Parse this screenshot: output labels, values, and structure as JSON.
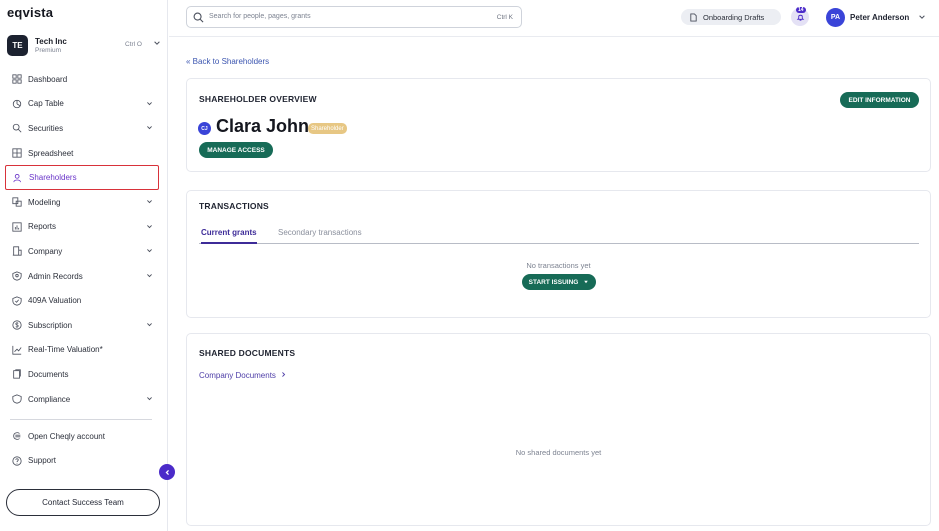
{
  "sidebar": {
    "logo": "eqvista",
    "company": {
      "initials": "TE",
      "name": "Tech Inc",
      "plan": "Premium",
      "shortcut": "Ctrl O"
    },
    "items": [
      {
        "label": "Dashboard",
        "icon": "dashboard-icon",
        "expandable": false
      },
      {
        "label": "Cap Table",
        "icon": "pie-chart-icon",
        "expandable": true
      },
      {
        "label": "Securities",
        "icon": "securities-icon",
        "expandable": true
      },
      {
        "label": "Spreadsheet",
        "icon": "grid-icon",
        "expandable": false
      },
      {
        "label": "Shareholders",
        "icon": "users-icon",
        "expandable": false,
        "active": true
      },
      {
        "label": "Modeling",
        "icon": "modeling-icon",
        "expandable": true
      },
      {
        "label": "Reports",
        "icon": "reports-icon",
        "expandable": true
      },
      {
        "label": "Company",
        "icon": "company-icon",
        "expandable": true
      },
      {
        "label": "Admin Records",
        "icon": "shield-user-icon",
        "expandable": true
      },
      {
        "label": "409A Valuation",
        "icon": "shield-check-icon",
        "expandable": false
      },
      {
        "label": "Subscription",
        "icon": "dollar-icon",
        "expandable": true
      },
      {
        "label": "Real-Time Valuation*",
        "icon": "trend-icon",
        "expandable": false
      },
      {
        "label": "Documents",
        "icon": "documents-icon",
        "expandable": false
      },
      {
        "label": "Compliance",
        "icon": "compliance-icon",
        "expandable": true
      }
    ],
    "extras": [
      {
        "label": "Open Cheqly account",
        "icon": "cheqly-icon"
      },
      {
        "label": "Support",
        "icon": "help-icon"
      }
    ],
    "contact_label": "Contact Success Team"
  },
  "topbar": {
    "search_placeholder": "Search for people, pages, grants",
    "search_shortcut": "Ctrl K",
    "drafts_label": "Onboarding Drafts",
    "notification_count": "14",
    "user_initials": "PA",
    "user_name": "Peter Anderson"
  },
  "main": {
    "back_label": "« Back to Shareholders",
    "overview": {
      "title": "SHAREHOLDER OVERVIEW",
      "edit_label": "EDIT INFORMATION",
      "initials": "CJ",
      "name": "Clara John",
      "badge": "Shareholder",
      "manage_label": "MANAGE ACCESS"
    },
    "transactions": {
      "title": "TRANSACTIONS",
      "tabs": [
        "Current grants",
        "Secondary transactions"
      ],
      "empty_text": "No transactions yet",
      "issue_label": "START ISSUING"
    },
    "documents": {
      "title": "SHARED DOCUMENTS",
      "link_label": "Company Documents",
      "empty_text": "No shared documents yet"
    }
  },
  "colors": {
    "accent_green": "#176b57",
    "accent_purple": "#4b2bc9",
    "active_border": "#d8323a",
    "badge": "#e7c784"
  }
}
